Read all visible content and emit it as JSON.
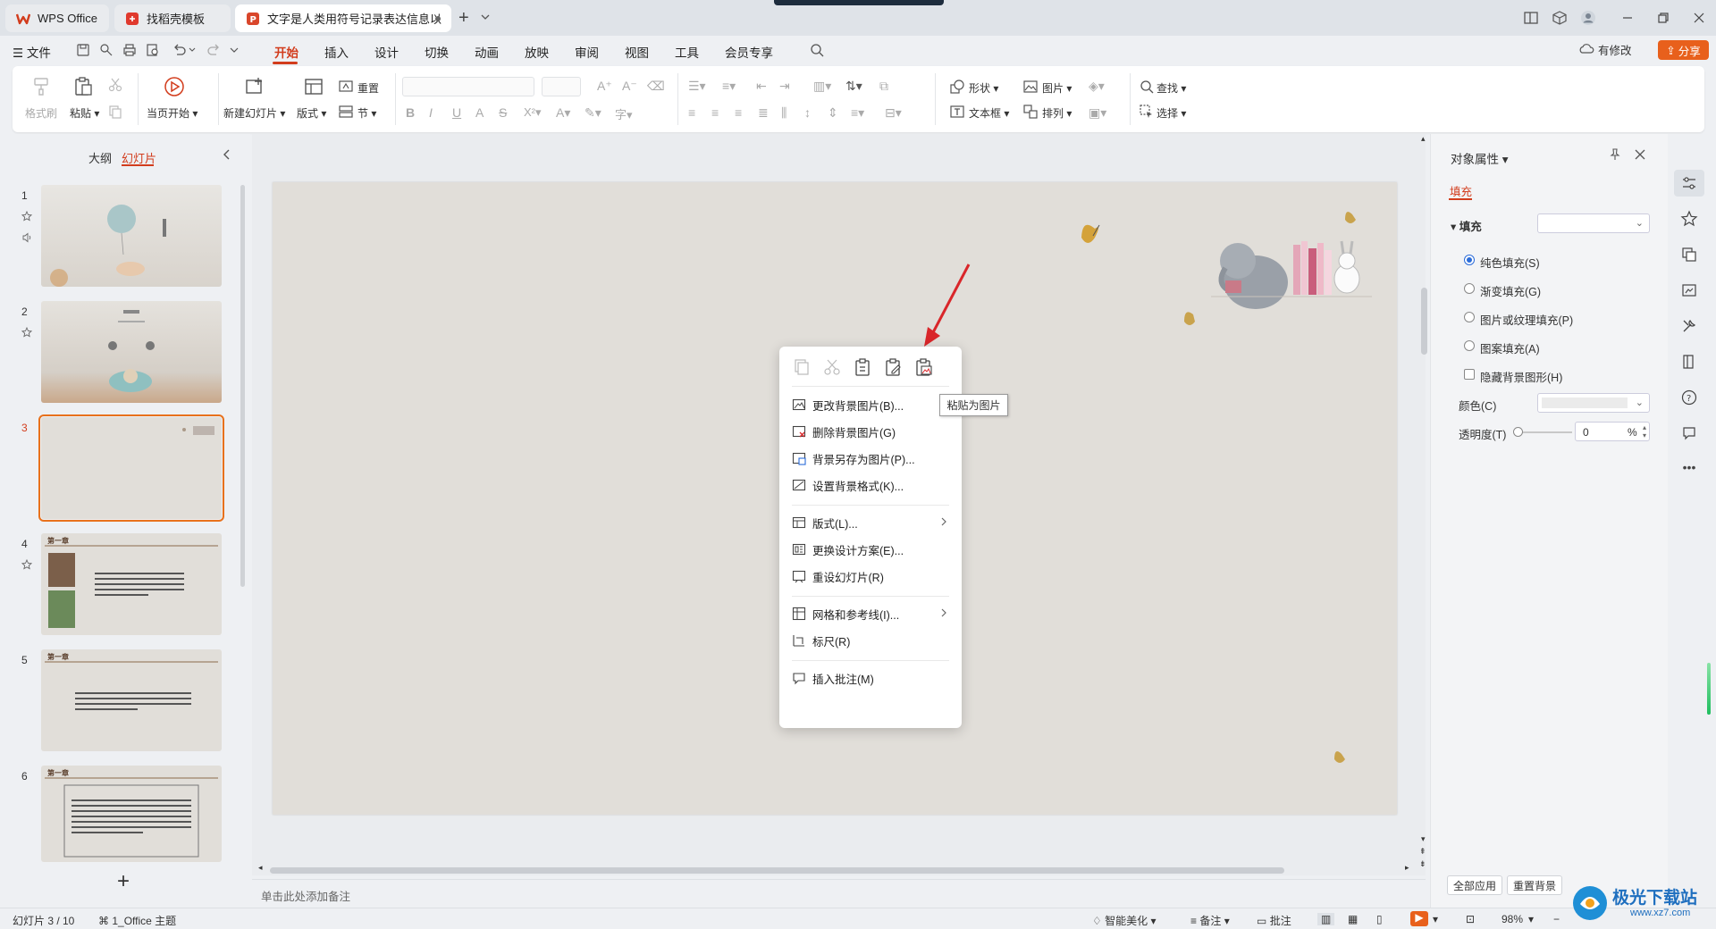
{
  "tabs": [
    {
      "label": "WPS Office"
    },
    {
      "label": "找稻壳模板"
    },
    {
      "label": "文字是人类用符号记录表达信息以"
    }
  ],
  "menu": {
    "file": "文件",
    "items": [
      "开始",
      "插入",
      "设计",
      "切换",
      "动画",
      "放映",
      "审阅",
      "视图",
      "工具",
      "会员专享"
    ],
    "active": "开始",
    "modified": "有修改",
    "share": "分享"
  },
  "ribbon": {
    "format_painter": "格式刷",
    "paste": "粘贴",
    "from_current": "当页开始",
    "new_slide": "新建幻灯片",
    "layout": "版式",
    "reset": "重置",
    "section": "节",
    "shape": "形状",
    "picture": "图片",
    "textbox": "文本框",
    "arrange": "排列",
    "find": "查找",
    "select": "选择"
  },
  "left_panel": {
    "outline_tab": "大纲",
    "slides_tab": "幻灯片",
    "thumb_chapter": "第一章",
    "slide_numbers": [
      "1",
      "2",
      "3",
      "4",
      "5",
      "6"
    ],
    "current_slide": "3"
  },
  "context_menu": {
    "tooltip": "粘贴为图片",
    "items": [
      {
        "label": "更改背景图片(B)..."
      },
      {
        "label": "删除背景图片(G)"
      },
      {
        "label": "背景另存为图片(P)..."
      },
      {
        "label": "设置背景格式(K)..."
      },
      {
        "label": "版式(L)..."
      },
      {
        "label": "更换设计方案(E)..."
      },
      {
        "label": "重设幻灯片(R)"
      },
      {
        "label": "网格和参考线(I)..."
      },
      {
        "label": "标尺(R)"
      },
      {
        "label": "插入批注(M)"
      }
    ]
  },
  "notes_placeholder": "单击此处添加备注",
  "right_panel": {
    "title": "对象属性",
    "fill_tab": "填充",
    "fill_section": "填充",
    "options": [
      "纯色填充(S)",
      "渐变填充(G)",
      "图片或纹理填充(P)",
      "图案填充(A)"
    ],
    "selected_option": "纯色填充(S)",
    "hide_bg": "隐藏背景图形(H)",
    "color_label": "颜色(C)",
    "transparency_label": "透明度(T)",
    "transparency_value": "0",
    "transparency_unit": "%",
    "apply_all": "全部应用",
    "reset_bg": "重置背景"
  },
  "status": {
    "slide_info": "幻灯片 3 / 10",
    "theme": "1_Office 主题",
    "beautify": "智能美化",
    "notes": "备注",
    "comments": "批注",
    "zoom": "98%"
  },
  "watermark": {
    "text": "极光下载站",
    "url_text": "www.xz7.com"
  },
  "colors": {
    "accent": "#d23c1c",
    "share": "#e8601c",
    "slide_bg": "#e1ded9",
    "arrow": "#d9262a"
  }
}
